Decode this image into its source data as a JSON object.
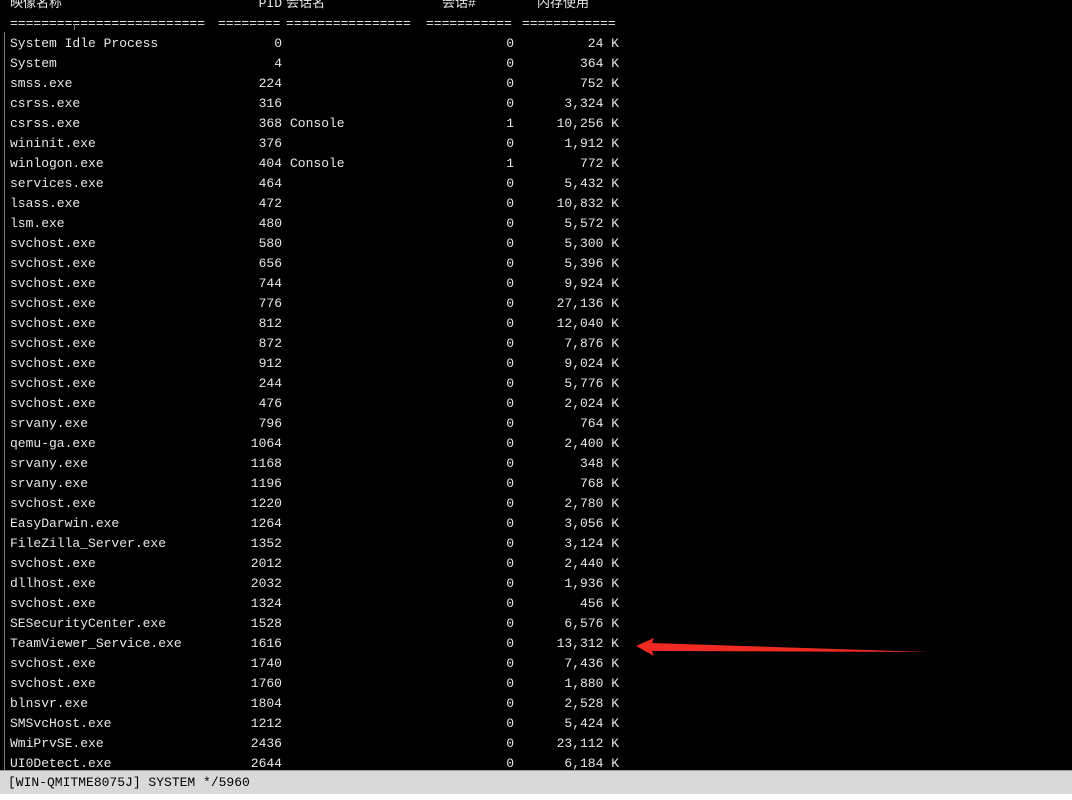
{
  "header": {
    "image_name": "映像名称",
    "pid": "PID",
    "session_name": "会话名",
    "session_num": "会话#",
    "mem_usage": "内存使用"
  },
  "separators": {
    "image_name": "=========================",
    "pid": "========",
    "session_name": "================",
    "session_num": "===========",
    "mem_usage": "============"
  },
  "processes": [
    {
      "name": "System Idle Process",
      "pid": "0",
      "session": "",
      "session_num": "0",
      "mem": "24 K"
    },
    {
      "name": "System",
      "pid": "4",
      "session": "",
      "session_num": "0",
      "mem": "364 K"
    },
    {
      "name": "smss.exe",
      "pid": "224",
      "session": "",
      "session_num": "0",
      "mem": "752 K"
    },
    {
      "name": "csrss.exe",
      "pid": "316",
      "session": "",
      "session_num": "0",
      "mem": "3,324 K"
    },
    {
      "name": "csrss.exe",
      "pid": "368",
      "session": "Console",
      "session_num": "1",
      "mem": "10,256 K"
    },
    {
      "name": "wininit.exe",
      "pid": "376",
      "session": "",
      "session_num": "0",
      "mem": "1,912 K"
    },
    {
      "name": "winlogon.exe",
      "pid": "404",
      "session": "Console",
      "session_num": "1",
      "mem": "772 K"
    },
    {
      "name": "services.exe",
      "pid": "464",
      "session": "",
      "session_num": "0",
      "mem": "5,432 K"
    },
    {
      "name": "lsass.exe",
      "pid": "472",
      "session": "",
      "session_num": "0",
      "mem": "10,832 K"
    },
    {
      "name": "lsm.exe",
      "pid": "480",
      "session": "",
      "session_num": "0",
      "mem": "5,572 K"
    },
    {
      "name": "svchost.exe",
      "pid": "580",
      "session": "",
      "session_num": "0",
      "mem": "5,300 K"
    },
    {
      "name": "svchost.exe",
      "pid": "656",
      "session": "",
      "session_num": "0",
      "mem": "5,396 K"
    },
    {
      "name": "svchost.exe",
      "pid": "744",
      "session": "",
      "session_num": "0",
      "mem": "9,924 K"
    },
    {
      "name": "svchost.exe",
      "pid": "776",
      "session": "",
      "session_num": "0",
      "mem": "27,136 K"
    },
    {
      "name": "svchost.exe",
      "pid": "812",
      "session": "",
      "session_num": "0",
      "mem": "12,040 K"
    },
    {
      "name": "svchost.exe",
      "pid": "872",
      "session": "",
      "session_num": "0",
      "mem": "7,876 K"
    },
    {
      "name": "svchost.exe",
      "pid": "912",
      "session": "",
      "session_num": "0",
      "mem": "9,024 K"
    },
    {
      "name": "svchost.exe",
      "pid": "244",
      "session": "",
      "session_num": "0",
      "mem": "5,776 K"
    },
    {
      "name": "svchost.exe",
      "pid": "476",
      "session": "",
      "session_num": "0",
      "mem": "2,024 K"
    },
    {
      "name": "srvany.exe",
      "pid": "796",
      "session": "",
      "session_num": "0",
      "mem": "764 K"
    },
    {
      "name": "qemu-ga.exe",
      "pid": "1064",
      "session": "",
      "session_num": "0",
      "mem": "2,400 K"
    },
    {
      "name": "srvany.exe",
      "pid": "1168",
      "session": "",
      "session_num": "0",
      "mem": "348 K"
    },
    {
      "name": "srvany.exe",
      "pid": "1196",
      "session": "",
      "session_num": "0",
      "mem": "768 K"
    },
    {
      "name": "svchost.exe",
      "pid": "1220",
      "session": "",
      "session_num": "0",
      "mem": "2,780 K"
    },
    {
      "name": "EasyDarwin.exe",
      "pid": "1264",
      "session": "",
      "session_num": "0",
      "mem": "3,056 K"
    },
    {
      "name": "FileZilla_Server.exe",
      "pid": "1352",
      "session": "",
      "session_num": "0",
      "mem": "3,124 K"
    },
    {
      "name": "svchost.exe",
      "pid": "2012",
      "session": "",
      "session_num": "0",
      "mem": "2,440 K"
    },
    {
      "name": "dllhost.exe",
      "pid": "2032",
      "session": "",
      "session_num": "0",
      "mem": "1,936 K"
    },
    {
      "name": "svchost.exe",
      "pid": "1324",
      "session": "",
      "session_num": "0",
      "mem": "456 K"
    },
    {
      "name": "SESecurityCenter.exe",
      "pid": "1528",
      "session": "",
      "session_num": "0",
      "mem": "6,576 K"
    },
    {
      "name": "TeamViewer_Service.exe",
      "pid": "1616",
      "session": "",
      "session_num": "0",
      "mem": "13,312 K"
    },
    {
      "name": "svchost.exe",
      "pid": "1740",
      "session": "",
      "session_num": "0",
      "mem": "7,436 K"
    },
    {
      "name": "svchost.exe",
      "pid": "1760",
      "session": "",
      "session_num": "0",
      "mem": "1,880 K"
    },
    {
      "name": "blnsvr.exe",
      "pid": "1804",
      "session": "",
      "session_num": "0",
      "mem": "2,528 K"
    },
    {
      "name": "SMSvcHost.exe",
      "pid": "1212",
      "session": "",
      "session_num": "0",
      "mem": "5,424 K"
    },
    {
      "name": "WmiPrvSE.exe",
      "pid": "2436",
      "session": "",
      "session_num": "0",
      "mem": "23,112 K"
    },
    {
      "name": "UI0Detect.exe",
      "pid": "2644",
      "session": "",
      "session_num": "0",
      "mem": "6,184 K"
    }
  ],
  "status_bar": {
    "text": "[WIN-QMITME8075J] SYSTEM */5960"
  },
  "annotation": {
    "arrow_color": "#ee2a22",
    "target_process": "TeamViewer_Service.exe"
  }
}
